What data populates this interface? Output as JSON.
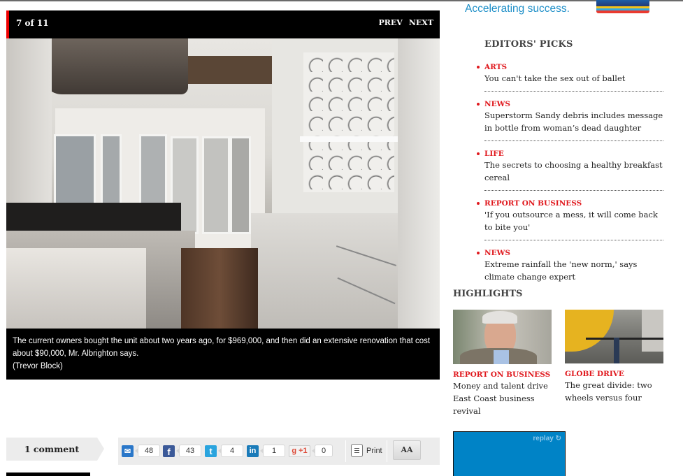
{
  "gallery": {
    "counter": "7 of 11",
    "prev_label": "PREV",
    "next_label": "NEXT",
    "photo_description": "Kitchen with island stove, white cabinets, wood floor and windows",
    "caption": "The current owners bought the unit about two years ago, for $969,000, and then did an extensive renovation that cost about $90,000, Mr. Albrighton says.",
    "credit": "(Trevor Block)"
  },
  "comments": {
    "label": "1 comment"
  },
  "share": {
    "items": [
      {
        "icon": "email-share-icon",
        "glyph": "✉",
        "count": "48",
        "color": "#2a77c9"
      },
      {
        "icon": "facebook-icon",
        "glyph": "f",
        "count": "43",
        "color": "#3b5998"
      },
      {
        "icon": "twitter-icon",
        "glyph": "t",
        "count": "4",
        "color": "#2aa4de"
      },
      {
        "icon": "linkedin-icon",
        "glyph": "in",
        "count": "1",
        "color": "#1a7bb9"
      },
      {
        "icon": "google-plus-icon",
        "glyph": "g +1",
        "count": "0",
        "color": "#dd4b39"
      }
    ],
    "print_label": "Print",
    "text_size_label": "AA"
  },
  "ad_top": {
    "tagline": "Accelerating success."
  },
  "editors_picks": {
    "title": "EDITORS' PICKS",
    "items": [
      {
        "category": "ARTS",
        "title": "You can't take the sex out of ballet"
      },
      {
        "category": "NEWS",
        "title": "Superstorm Sandy debris includes message in bottle from woman’s dead daughter"
      },
      {
        "category": "LIFE",
        "title": "The secrets to choosing a healthy breakfast cereal"
      },
      {
        "category": "REPORT ON BUSINESS",
        "title": "'If you outsource a mess, it will come back to bite you'"
      },
      {
        "category": "NEWS",
        "title": "Extreme rainfall the 'new norm,' says climate change expert"
      }
    ]
  },
  "highlights": {
    "title": "HIGHLIGHTS",
    "items": [
      {
        "category": "REPORT ON BUSINESS",
        "title": "Money and talent drive East Coast business revival"
      },
      {
        "category": "GLOBE DRIVE",
        "title": "The great divide: two wheels versus four"
      }
    ]
  },
  "ad_box": {
    "replay_label": "replay ↻"
  },
  "colors": {
    "accent_red": "#e0191e",
    "ad_blue": "#0083c6"
  }
}
